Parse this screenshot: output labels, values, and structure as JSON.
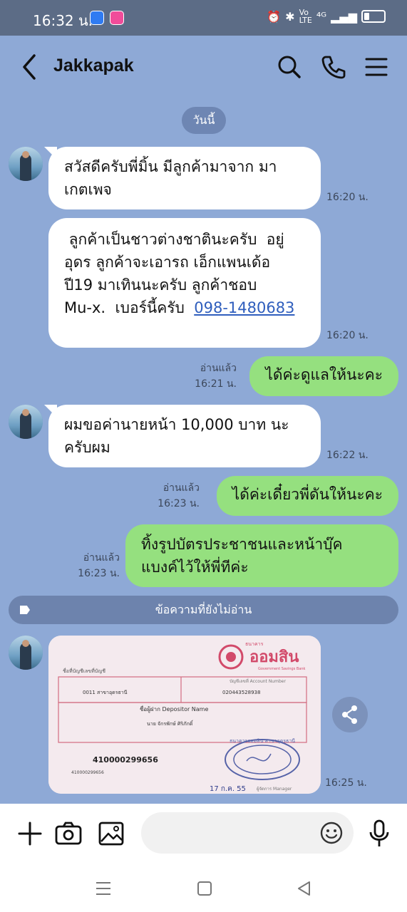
{
  "status_bar": {
    "time": "16:32 น.",
    "network": "⁴ᴳ"
  },
  "header": {
    "contact_name": "Jakkapak"
  },
  "date_chip": "วันนี้",
  "messages": [
    {
      "type": "in",
      "text_lines": [
        "สวัสดีครับพี่มิ้น  มีลูกค้ามาจาก มา",
        "เกตเพจ"
      ],
      "time": "16:20 น."
    },
    {
      "type": "in",
      "text_lines": [
        " ลูกค้าเป็นชาวต่างชาตินะครับ  อยู่",
        "อุดร  ลูกค้าจะเอารถ เอ็กแพนเด้อ",
        "ปี19  มาเทินนะครับ  ลูกค้าชอบ",
        "Mu-x.  เบอร์นี้ครับ  "
      ],
      "link": "098-1480683",
      "time": "16:20 น."
    },
    {
      "type": "out",
      "text": "ได้ค่ะดูแลให้นะคะ",
      "read": "อ่านแล้ว",
      "time": "16:21 น."
    },
    {
      "type": "in",
      "text_lines": [
        "ผมขอค่านายหน้า 10,000 บาท นะ",
        "ครับผม"
      ],
      "time": "16:22 น."
    },
    {
      "type": "out",
      "text": "ได้ค่ะเดี๋ยวพี่ดันให้นะคะ",
      "read": "อ่านแล้ว",
      "time": "16:23 น."
    },
    {
      "type": "out",
      "text_lines": [
        "ทิ้งรูปบัตรประชาชนและหน้าบุ๊ค",
        "แบงค์ไว้ให้พี่ทีค่ะ"
      ],
      "read": "อ่านแล้ว",
      "time": "16:23 น."
    }
  ],
  "unread_divider": "ข้อความที่ยังไม่อ่าน",
  "image_message": {
    "time": "16:25 น.",
    "bank_name_small": "ธนาคาร",
    "bank_name": "ออมสิน",
    "bank_name_en": "Government Savings Bank",
    "branch_label": "ชื่อที่บัญชีเลขที่บัญชี",
    "branch_value": "0011  สาขาอุดรธานี",
    "account_label": "บัญชีเลขที่ Account Number",
    "account_value": "020443528938",
    "depositor_label": "ชื่อผู้ฝาก Depositor Name",
    "depositor_value": "นาย จักรพักษ์ ศิริภักดิ์",
    "number_big": "410000299656",
    "number_small": "410000299656",
    "stamp_text": "ธนาคารออมสิน สาขาอุดรธานี",
    "date_text": "17 ก.ค. 55",
    "manager_label": "ผู้จัดการ Manager"
  },
  "input": {
    "placeholder": ""
  }
}
